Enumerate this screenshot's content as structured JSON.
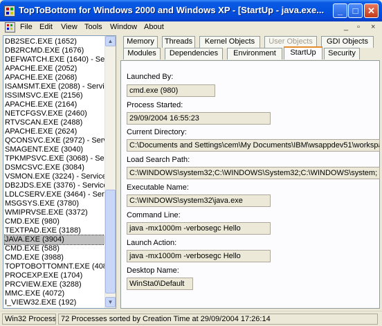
{
  "window": {
    "title": "TopToBottom for Windows 2000 and Windows XP - [StartUp - java.exe..."
  },
  "menu": {
    "items": [
      "File",
      "Edit",
      "View",
      "Tools",
      "Window",
      "About"
    ],
    "mdi_controls": [
      "_",
      "▫",
      "×"
    ]
  },
  "process_list": [
    "DB2SEC.EXE (1652)",
    "DB2RCMD.EXE (1676)",
    "DEFWATCH.EXE (1640) - Serv",
    "APACHE.EXE (2052)",
    "APACHE.EXE (2068)",
    "ISAMSMT.EXE (2088) - Service",
    "ISSIMSVC.EXE (2156)",
    "APACHE.EXE (2164)",
    "NETCFGSV.EXE (2460)",
    "RTVSCAN.EXE (2488)",
    "APACHE.EXE (2624)",
    "QCONSVC.EXE (2972) - Servi",
    "SMAGENT.EXE (3040)",
    "TPKMPSVC.EXE (3068) - Serv",
    "DSMCSVC.EXE (3084)",
    "VSMON.EXE (3224) - Service",
    "DB2JDS.EXE (3376) - Service",
    "LDLCSERV.EXE (3464) - Serv",
    "MSGSYS.EXE (3780)",
    "WMIPRVSE.EXE (3372)",
    "CMD.EXE (980)",
    "TEXTPAD.EXE (3188)",
    "JAVA.EXE (3904)",
    "CMD.EXE (588)",
    "CMD.EXE (3988)",
    "TOPTOBOTTOMNT.EXE (408",
    "PROCEXP.EXE (1704)",
    "PRCVIEW.EXE (3288)",
    "MMC.EXE (4072)",
    "I_VIEW32.EXE (192)"
  ],
  "selected_process": "JAVA.EXE (3904)",
  "tabs": {
    "row1": [
      "Memory",
      "Threads",
      "Kernel Objects",
      "User Objects",
      "GDI Objects"
    ],
    "row2": [
      "Modules",
      "Dependencies",
      "Environment",
      "StartUp",
      "Security"
    ],
    "active": "StartUp",
    "disabled": "User Objects"
  },
  "startup": {
    "launched_by_label": "Launched By:",
    "launched_by": "cmd.exe (980)",
    "process_started_label": "Process Started:",
    "process_started": "29/09/2004 16:55:23",
    "current_dir_label": "Current Directory:",
    "current_dir": "C:\\Documents and Settings\\cem\\My Documents\\IBM\\wsappdev51\\workspa",
    "load_path_label": "Load Search Path:",
    "load_path": "C:\\WINDOWS\\system32;C:\\WINDOWS\\System32;C:\\WINDOWS\\system;",
    "executable_label": "Executable Name:",
    "executable": "C:\\WINDOWS\\system32\\java.exe",
    "command_line_label": "Command Line:",
    "command_line": "java -mx1000m -verbosegc Hello",
    "launch_action_label": "Launch Action:",
    "launch_action": "java -mx1000m -verbosegc Hello",
    "desktop_label": "Desktop Name:",
    "desktop": "WinSta0\\Default"
  },
  "status": {
    "left": "Win32 Process",
    "right": "72 Processes sorted by Creation Time at 29/09/2004 17:26:14"
  }
}
